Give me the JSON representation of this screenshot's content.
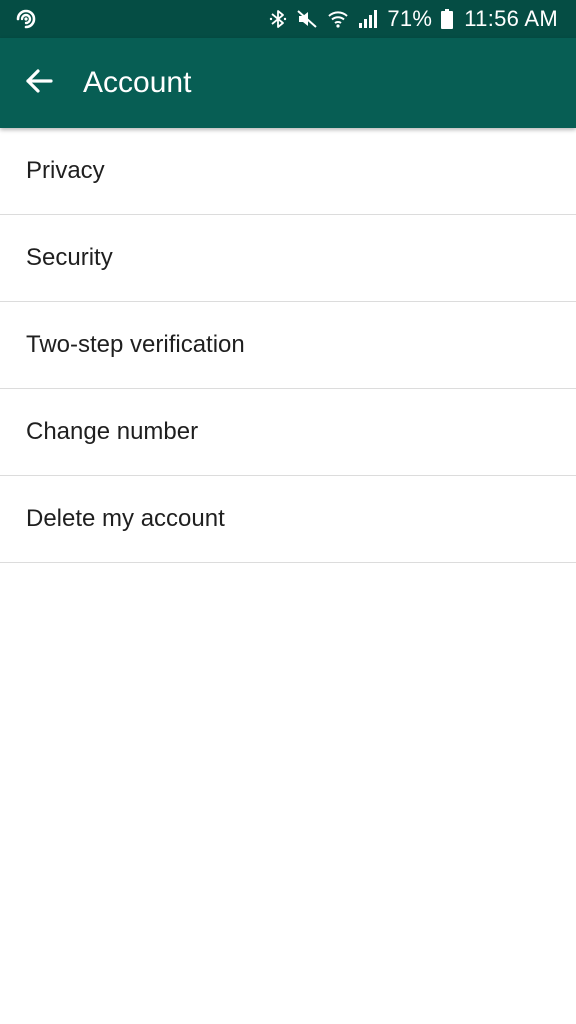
{
  "status_bar": {
    "battery_percent": "71%",
    "time": "11:56 AM",
    "icons": [
      "app-notification-icon",
      "bluetooth-icon",
      "mute-icon",
      "wifi-icon",
      "signal-icon",
      "battery-icon"
    ]
  },
  "app_bar": {
    "title": "Account",
    "back_icon": "arrow-back-icon",
    "background_color": "#075e54"
  },
  "menu": {
    "items": [
      {
        "label": "Privacy"
      },
      {
        "label": "Security"
      },
      {
        "label": "Two-step verification"
      },
      {
        "label": "Change number"
      },
      {
        "label": "Delete my account"
      }
    ]
  }
}
